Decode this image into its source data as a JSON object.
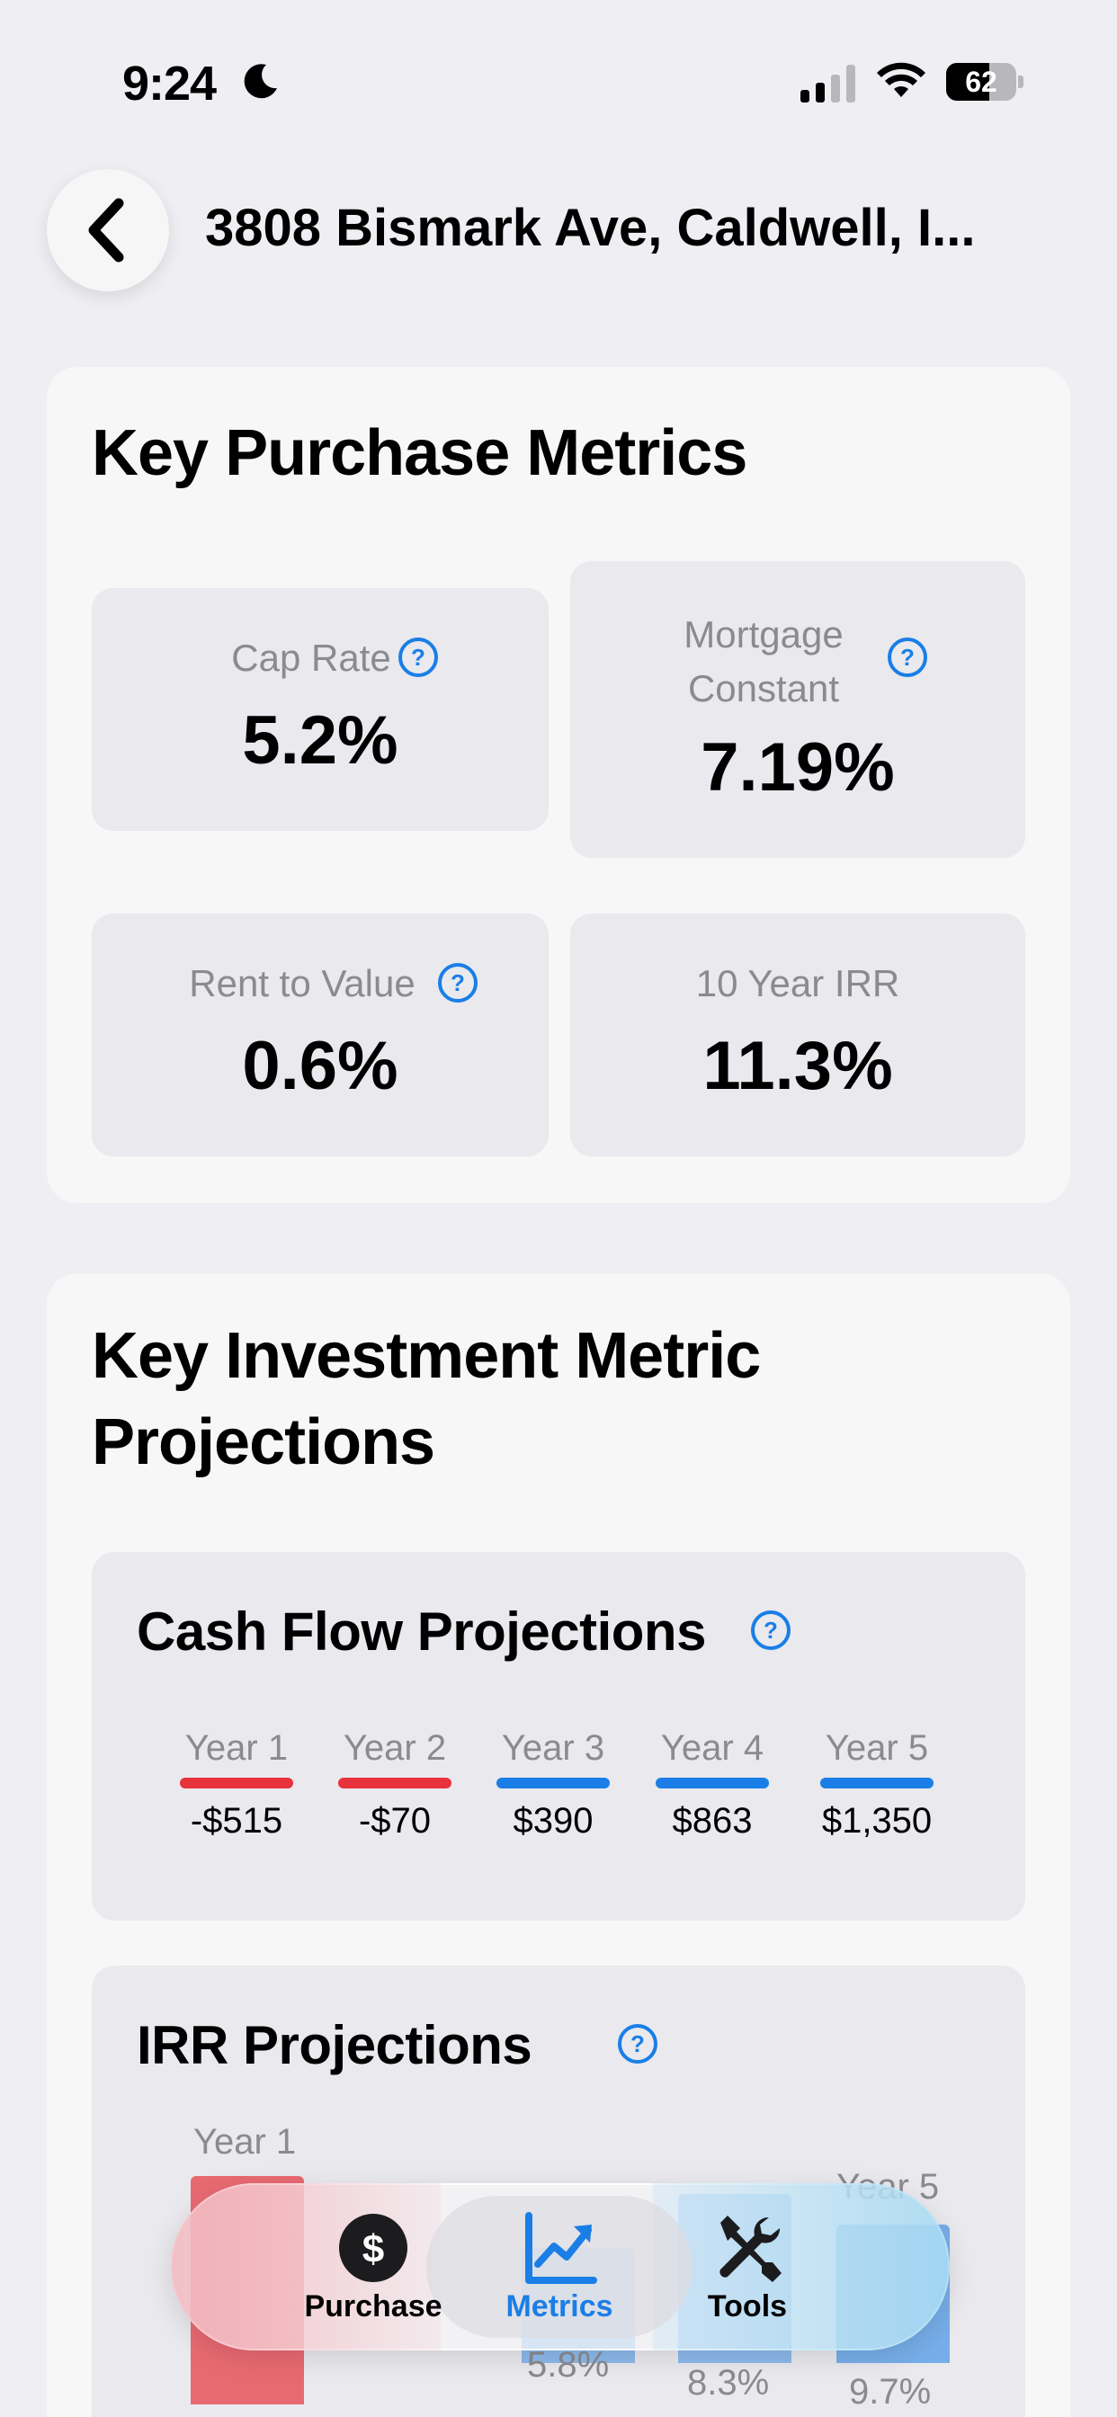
{
  "status_bar": {
    "time": "9:24",
    "battery": "62",
    "battery_level": 0.62
  },
  "header": {
    "title": "3808 Bismark Ave, Caldwell, I..."
  },
  "purchase_metrics": {
    "title": "Key Purchase Metrics",
    "items": [
      {
        "label": "Cap Rate",
        "value": "5.2%"
      },
      {
        "label": "Mortgage\nConstant",
        "value": "7.19%"
      },
      {
        "label": "Rent to Value",
        "value": "0.6%"
      },
      {
        "label": "10 Year IRR",
        "value": "11.3%"
      }
    ]
  },
  "investment": {
    "title": "Key Investment Metric\nProjections",
    "cash_flow": {
      "title": "Cash Flow Projections",
      "years": [
        {
          "year": "Year 1",
          "value": "-$515",
          "color": "#e8333c"
        },
        {
          "year": "Year 2",
          "value": "-$70",
          "color": "#e8333c"
        },
        {
          "year": "Year 3",
          "value": "$390",
          "color": "#1a7ee6"
        },
        {
          "year": "Year 4",
          "value": "$863",
          "color": "#1a7ee6"
        },
        {
          "year": "Year 5",
          "value": "$1,350",
          "color": "#1a7ee6"
        }
      ]
    },
    "irr": {
      "title": "IRR Projections",
      "year_first": "Year 1",
      "year_last": "Year 5",
      "visible_values": [
        "5.8%",
        "8.3%",
        "9.7%"
      ]
    }
  },
  "tab_bar": {
    "tabs": [
      {
        "label": "Purchase",
        "icon": "dollar-icon",
        "selected": false
      },
      {
        "label": "Metrics",
        "icon": "chart-icon",
        "selected": true
      },
      {
        "label": "Tools",
        "icon": "tools-icon",
        "selected": false
      }
    ]
  },
  "colors": {
    "accent": "#1a7ee6",
    "negative": "#e8333c",
    "help": "#1a7ee6"
  }
}
